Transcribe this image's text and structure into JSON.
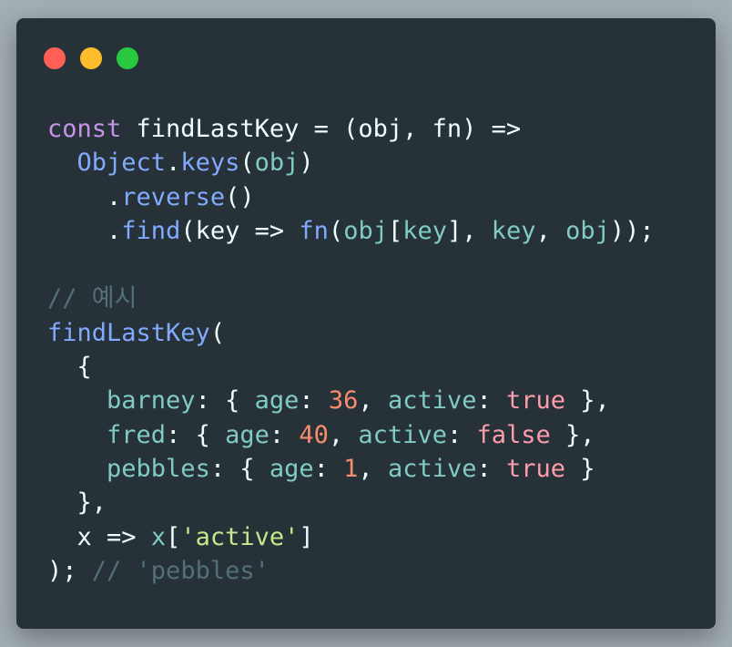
{
  "window": {
    "controls": [
      {
        "name": "close",
        "color": "#ff5f56"
      },
      {
        "name": "minimize",
        "color": "#ffbd2e"
      },
      {
        "name": "maximize",
        "color": "#27c93f"
      }
    ]
  },
  "code": {
    "l1": {
      "kw": "const",
      "rest": " findLastKey = (obj, fn) =>"
    },
    "l2": {
      "indent": "  ",
      "obj": "Object",
      "dot": ".",
      "keys": "keys",
      "open": "(",
      "arg": "obj",
      "close": ")"
    },
    "l3": {
      "indent": "    ",
      "dot": ".",
      "method": "reverse",
      "parens": "()"
    },
    "l4": {
      "indent": "    ",
      "dot": ".",
      "method": "find",
      "open": "(",
      "param": "key",
      "arrow": " => ",
      "fn": "fn",
      "open2": "(",
      "obj": "obj",
      "br1": "[",
      "key1": "key",
      "br2": "], ",
      "key2": "key",
      "comma": ", ",
      "obj2": "obj",
      "end": "));"
    },
    "l6": {
      "comment": "// 예시"
    },
    "l7": {
      "fn": "findLastKey",
      "open": "("
    },
    "l8": {
      "indent": "  ",
      "brace": "{"
    },
    "l9": {
      "indent": "    ",
      "key": "barney",
      "colon": ": { ",
      "agek": "age",
      "c2": ": ",
      "age": "36",
      "c3": ", ",
      "actk": "active",
      "c4": ": ",
      "act": "true",
      "end": " },"
    },
    "l10": {
      "indent": "    ",
      "key": "fred",
      "colon": ": { ",
      "agek": "age",
      "c2": ": ",
      "age": "40",
      "c3": ", ",
      "actk": "active",
      "c4": ": ",
      "act": "false",
      "end": " },"
    },
    "l11": {
      "indent": "    ",
      "key": "pebbles",
      "colon": ": { ",
      "agek": "age",
      "c2": ": ",
      "age": "1",
      "c3": ", ",
      "actk": "active",
      "c4": ": ",
      "act": "true",
      "end": " }"
    },
    "l12": {
      "indent": "  ",
      "text": "},"
    },
    "l13": {
      "indent": "  ",
      "param": "x",
      "arrow": " => ",
      "var": "x",
      "br1": "[",
      "str": "'active'",
      "br2": "]"
    },
    "l14": {
      "text": ");",
      "space": " ",
      "comment": "// 'pebbles'"
    }
  }
}
